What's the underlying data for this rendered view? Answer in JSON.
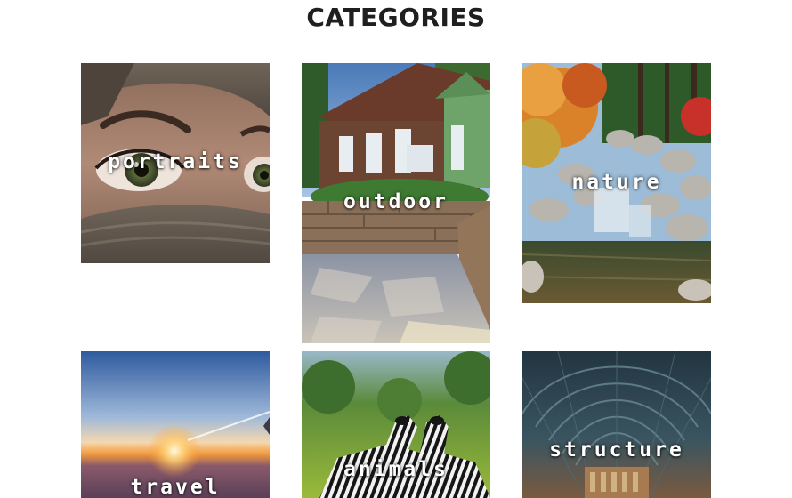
{
  "page": {
    "title": "CATEGORIES"
  },
  "categories": [
    {
      "label": "portraits",
      "image": "portrait-eyes-photo"
    },
    {
      "label": "outdoor",
      "image": "house-stone-wall-photo"
    },
    {
      "label": "nature",
      "image": "waterfall-autumn-photo"
    },
    {
      "label": "travel",
      "image": "sunset-above-clouds-photo"
    },
    {
      "label": "animals",
      "image": "zebras-photo"
    },
    {
      "label": "structure",
      "image": "arched-hall-photo"
    }
  ],
  "colors": {
    "title": "#1f1f1f",
    "label": "#ffffff",
    "background": "#ffffff"
  }
}
